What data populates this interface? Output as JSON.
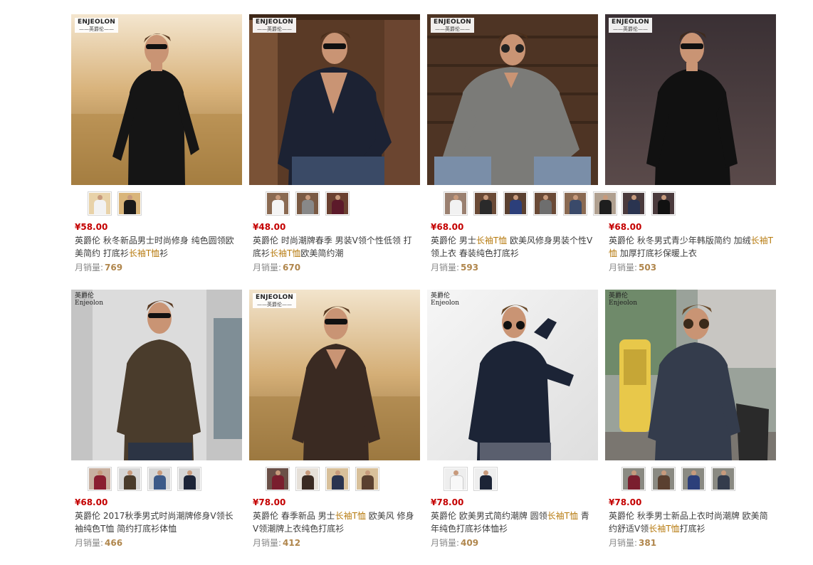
{
  "brand": {
    "logo_en": "ENJEOLON",
    "logo_cn": "——英爵伦——",
    "logo_cn_plain": "英爵伦",
    "logo_en_plain": "Enjeolon"
  },
  "products": [
    {
      "price": "¥58.00",
      "title_a": "英爵伦 秋冬新品男士时尚修身 纯色圆领欧美简约 打底衫",
      "kw": "长袖T恤",
      "title_b": "衫",
      "sales_label": "月销量:",
      "sales": "769"
    },
    {
      "price": "¥48.00",
      "title_a": "英爵伦 时尚潮牌春季 男装V领个性低领 打底衫",
      "kw": "长袖T恤",
      "title_b": "欧美简约潮",
      "sales_label": "月销量:",
      "sales": "670"
    },
    {
      "price": "¥68.00",
      "title_a": "英爵伦 男士",
      "kw": "长袖T恤",
      "title_b": " 欧美风修身男装个性V领上衣 春装纯色打底衫",
      "sales_label": "月销量:",
      "sales": "593"
    },
    {
      "price": "¥68.00",
      "title_a": "英爵伦 秋冬男式青少年韩版简约 加绒",
      "kw": "长袖T恤",
      "title_b": " 加厚打底衫保暖上衣",
      "sales_label": "月销量:",
      "sales": "503"
    },
    {
      "price": "¥68.00",
      "title_a": "英爵伦 2017秋季男式时尚潮牌修身V领长袖纯色T恤 简约打底衫体恤",
      "kw": "",
      "title_b": "",
      "sales_label": "月销量:",
      "sales": "466"
    },
    {
      "price": "¥78.00",
      "title_a": "英爵伦 春季新品 男士",
      "kw": "长袖T恤",
      "title_b": " 欧美风 修身V领潮牌上衣纯色打底衫",
      "sales_label": "月销量:",
      "sales": "412"
    },
    {
      "price": "¥78.00",
      "title_a": "英爵伦 欧美男式简约潮牌 圆领",
      "kw": "长袖T恤",
      "title_b": " 青年纯色打底衫体恤衫",
      "sales_label": "月销量:",
      "sales": "409"
    },
    {
      "price": "¥78.00",
      "title_a": "英爵伦 秋季男士新品上衣时尚潮牌 欧美简约舒适V领",
      "kw": "长袖T恤",
      "title_b": "打底衫",
      "sales_label": "月销量:",
      "sales": "381"
    }
  ],
  "colors": {
    "price": "#c40000",
    "keyword": "#b77b10",
    "sales_number": "#b0864c"
  }
}
